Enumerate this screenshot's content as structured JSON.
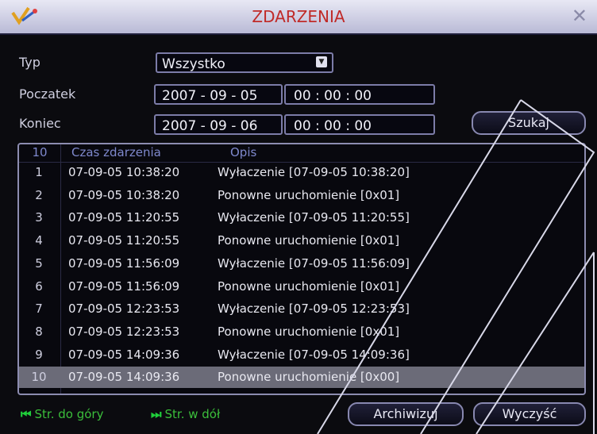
{
  "window": {
    "title": "ZDARZENIA"
  },
  "form": {
    "typ_label": "Typ",
    "typ_value": "Wszystko",
    "poczatek_label": "Poczatek",
    "poczatek_date": "2007 - 09 - 05",
    "poczatek_time": "00 : 00 : 00",
    "koniec_label": "Koniec",
    "koniec_date": "2007 - 09 - 06",
    "koniec_time": "00 : 00 : 00",
    "search_button": "Szukaj"
  },
  "table": {
    "count_header": "10",
    "col_time": "Czas zdarzenia",
    "col_desc": "Opis",
    "selected_row": 10,
    "rows": [
      {
        "num": "1",
        "time": "07-09-05 10:38:20",
        "desc": "Wyłaczenie [07-09-05 10:38:20]"
      },
      {
        "num": "2",
        "time": "07-09-05 10:38:20",
        "desc": "Ponowne uruchomienie [0x01]"
      },
      {
        "num": "3",
        "time": "07-09-05 11:20:55",
        "desc": "Wyłaczenie [07-09-05 11:20:55]"
      },
      {
        "num": "4",
        "time": "07-09-05 11:20:55",
        "desc": "Ponowne uruchomienie [0x01]"
      },
      {
        "num": "5",
        "time": "07-09-05 11:56:09",
        "desc": "Wyłaczenie [07-09-05 11:56:09]"
      },
      {
        "num": "6",
        "time": "07-09-05 11:56:09",
        "desc": "Ponowne uruchomienie [0x01]"
      },
      {
        "num": "7",
        "time": "07-09-05 12:23:53",
        "desc": "Wyłaczenie [07-09-05 12:23:53]"
      },
      {
        "num": "8",
        "time": "07-09-05 12:23:53",
        "desc": "Ponowne uruchomienie [0x01]"
      },
      {
        "num": "9",
        "time": "07-09-05 14:09:36",
        "desc": "Wyłaczenie [07-09-05 14:09:36]"
      },
      {
        "num": "10",
        "time": "07-09-05 14:09:36",
        "desc": "Ponowne uruchomienie [0x00]"
      }
    ]
  },
  "footer": {
    "page_up": "Str. do góry",
    "page_down": "Str. w dół",
    "archive_button": "Archiwizuj",
    "clear_button": "Wyczyść"
  },
  "colors": {
    "title_text": "#c02a28",
    "nav_green": "#3bbf3b",
    "header_blue": "#7e88cc",
    "selected_row": "#6b6b78"
  },
  "icons": {
    "title_logo": "app-logo-icon",
    "close": "close-icon",
    "dropdown": "chevron-down-icon",
    "page_up": "page-up-arrow-icon",
    "page_down": "page-down-arrow-icon"
  }
}
